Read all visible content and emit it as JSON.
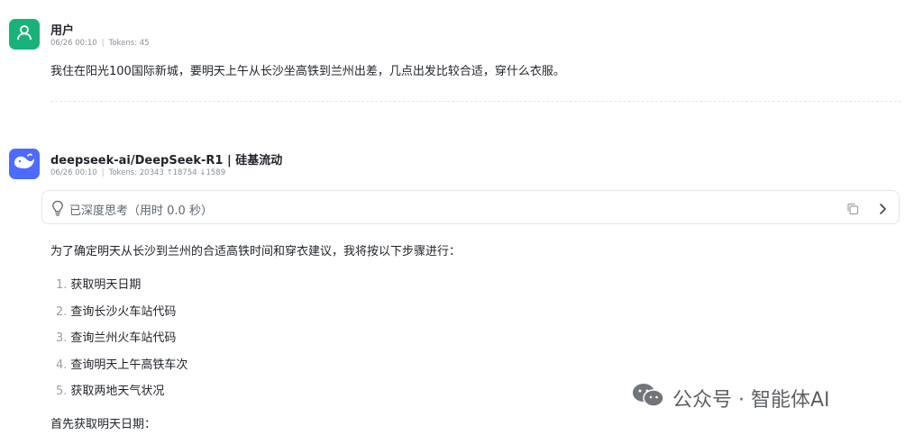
{
  "user_message": {
    "name": "用户",
    "time": "06/26 00:10",
    "tokens": "Tokens: 45",
    "text": "我住在阳光100国际新城，要明天上午从长沙坐高铁到兰州出差，几点出发比较合适，穿什么衣服。",
    "avatar_icon": "person-icon"
  },
  "assistant_message": {
    "name": "deepseek-ai/DeepSeek-R1 | 硅基流动",
    "time": "06/26 00:10",
    "tokens": "Tokens: 20343 ↑18754 ↓1589",
    "avatar_icon": "whale-icon",
    "thinking": {
      "label": "已深度思考（用时 0.0 秒）",
      "bulb_icon": "lightbulb-icon",
      "copy_icon": "copy-icon",
      "expand_icon": "chevron-right-icon"
    },
    "intro": "为了确定明天从长沙到兰州的合适高铁时间和穿衣建议，我将按以下步骤进行：",
    "steps": [
      {
        "num": "1.",
        "text": "获取明天日期"
      },
      {
        "num": "2.",
        "text": "查询长沙火车站代码"
      },
      {
        "num": "3.",
        "text": "查询兰州火车站代码"
      },
      {
        "num": "4.",
        "text": "查询明天上午高铁车次"
      },
      {
        "num": "5.",
        "text": "获取两地天气状况"
      }
    ],
    "outro": "首先获取明天日期："
  },
  "watermark": {
    "text": "公众号 · 智能体AI",
    "icon": "wechat-icon"
  },
  "colors": {
    "user_avatar": "#19b37a",
    "bot_avatar": "#4d6bfe",
    "text": "#1f2329",
    "muted": "#8a8f99"
  }
}
